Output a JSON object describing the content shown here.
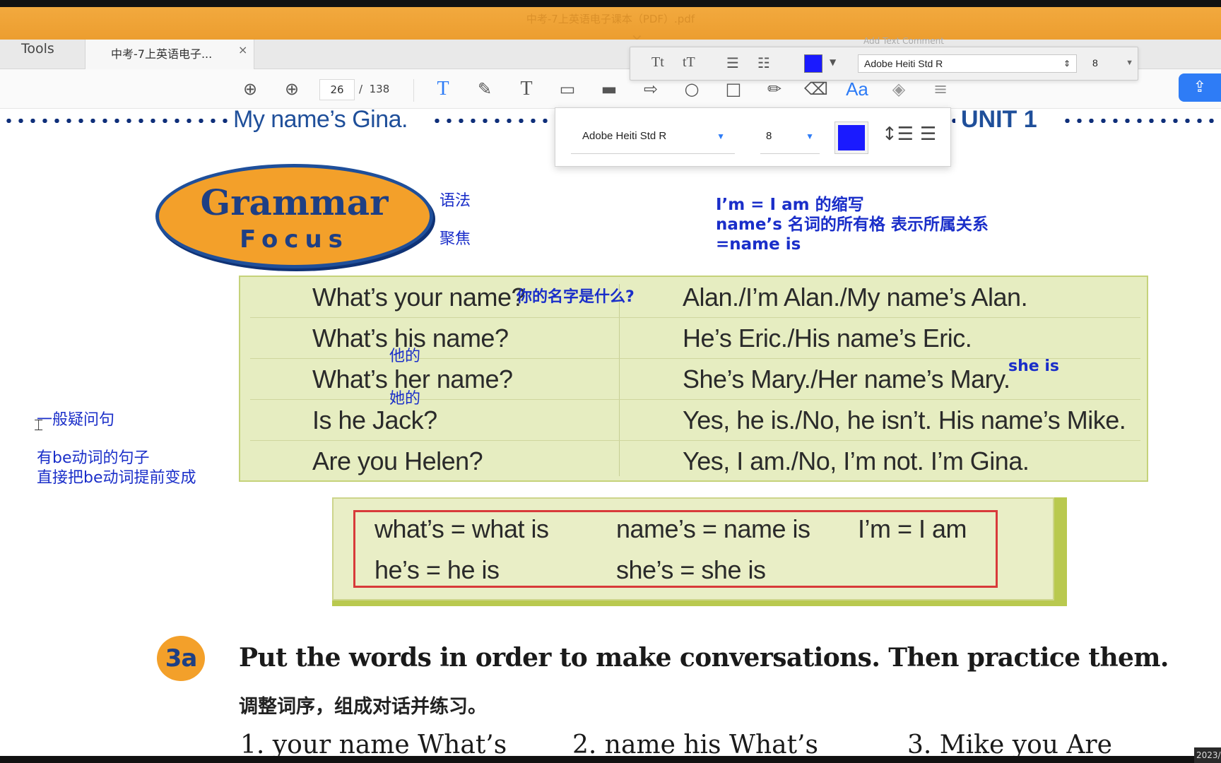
{
  "window": {
    "title": "中考-7上英语电子课本（PDF）.pdf",
    "close_glyph": "✕"
  },
  "tabs": {
    "tools": "Tools",
    "document": "中考-7上英语电子...",
    "close_glyph": "×"
  },
  "toolbar": {
    "page_current": "26",
    "page_separator": "/",
    "page_total": "138"
  },
  "text_props": {
    "panel_title": "Add Text Comment",
    "font": "Adobe Heiti Std R",
    "size": "8",
    "color": "#1a1aff"
  },
  "page": {
    "header_left": "My name’s Gina.",
    "header_right": "UNIT 1",
    "logo_line1": "Grammar",
    "logo_line2": "Focus",
    "grammar_rows": [
      {
        "q": "What’s your name?",
        "a": "Alan./I’m Alan./My name’s Alan."
      },
      {
        "q": "What’s his name?",
        "a": "He’s Eric./His name’s Eric."
      },
      {
        "q": "What’s her name?",
        "a": "She’s Mary./Her name’s Mary."
      },
      {
        "q": "Is he Jack?",
        "a": "Yes, he is./No, he isn’t. His name’s Mike."
      },
      {
        "q": "Are you Helen?",
        "a": "Yes, I am./No, I’m not. I’m Gina."
      }
    ],
    "contractions": {
      "c1": "what’s = what is",
      "c2": "name’s = name is",
      "c3": "I’m = I am",
      "c4": "he’s = he is",
      "c5": "she’s = she is"
    },
    "exercise_badge": "3a",
    "exercise_instruction": "Put the words in order to make conversations. Then practice them.",
    "exercise_instruction_cn": "调整词序，组成对话并练习。",
    "exercise_items": [
      "1. your name What’s",
      "2. name his What’s",
      "3. Mike you Are"
    ]
  },
  "annotations": {
    "grammar": "语法",
    "focus": "聚焦",
    "im": "I’m = I am 的缩写",
    "names_line1": "name’s 名词的所有格 表示所属关系",
    "names_line2": "=name is",
    "your_name": "你的名字是什么?",
    "his": "他的",
    "her": "她的",
    "she_is": "she is",
    "general_q": "一般疑问句",
    "be_line1": "有be动词的句子",
    "be_line2": "直接把be动词提前变成"
  },
  "taskbar": {
    "clock": "2023/"
  }
}
